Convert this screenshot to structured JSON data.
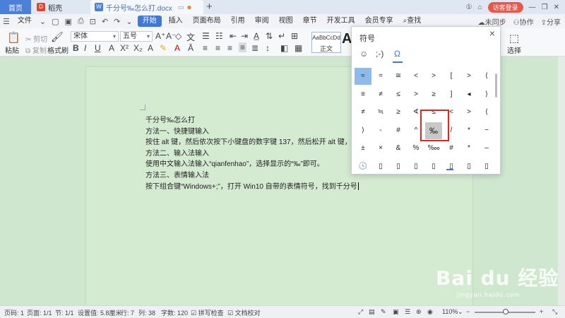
{
  "tabs": {
    "home": "首页",
    "daoke": "稻壳",
    "doc": "千分号‰怎么打.docx",
    "new_tab": "+"
  },
  "titlebar": {
    "login": "访客登录"
  },
  "menu": {
    "file": "文件",
    "items": [
      "开始",
      "插入",
      "页面布局",
      "引用",
      "审阅",
      "视图",
      "章节",
      "开发工具",
      "会员专享"
    ],
    "search": "查找",
    "right": {
      "sync": "未同步",
      "collab": "协作",
      "share": "分享"
    }
  },
  "ribbon": {
    "paste": "粘贴",
    "cut": "剪切",
    "copy": "复制",
    "format_painter": "格式刷",
    "font_name": "宋体",
    "font_size": "五号",
    "style_sample": "AaBbCcDd",
    "style_label": "正文",
    "big_a": "A",
    "select": "选择"
  },
  "document": {
    "lines": [
      "千分号‰怎么打",
      "方法一、快捷键输入",
      "按住 alt 键，然后依次按下小键盘的数字键 137，然后松开 alt 键，就可",
      "方法二、输入法输入",
      "使用中文输入法输入“qianfenhao”，选择显示的“‰”即可。",
      "方法三、表情输入法",
      "按下组合键“Windows+;”，打开 Win10 自带的表情符号，找到千分号"
    ]
  },
  "symbol_dialog": {
    "title": "符号",
    "close": "×",
    "tabs": [
      "☺",
      ";-)",
      "Ω"
    ],
    "rows": [
      [
        "≈",
        "=",
        "≅",
        "<",
        ">",
        "[",
        ">",
        "⟨"
      ],
      [
        "≡",
        "≠",
        "≤",
        ">",
        "≥",
        "]",
        "◂",
        "⟩"
      ],
      [
        "≠",
        "≒",
        "≥",
        "∢",
        "≤",
        "<",
        ">",
        "⟨"
      ],
      [
        "⟩",
        "-",
        "#",
        "^",
        "‰",
        "/",
        "*",
        "~"
      ],
      [
        "±",
        "×",
        "&",
        "%",
        "‱",
        "#",
        "*",
        "–"
      ],
      [
        "🕓",
        "▯",
        "▯",
        "▯",
        "▯",
        "▯",
        "▯",
        "▯"
      ]
    ]
  },
  "statusbar": {
    "page_no": "页码: 1",
    "page": "页面: 1/1",
    "section": "节: 1/1",
    "setting": "设置值: 5.8厘米",
    "line": "行: 7",
    "col": "列: 38",
    "words": "字数: 120",
    "spell": "拼写检查",
    "proof": "文档校对",
    "zoom": "110%"
  },
  "watermark": {
    "text": "Bai du 经验",
    "sub": "jingyan.baidu.com"
  },
  "colors": {
    "accent": "#3e79d6",
    "highlight_box": "#e0271d",
    "page_bg": "#d4ebd2"
  }
}
